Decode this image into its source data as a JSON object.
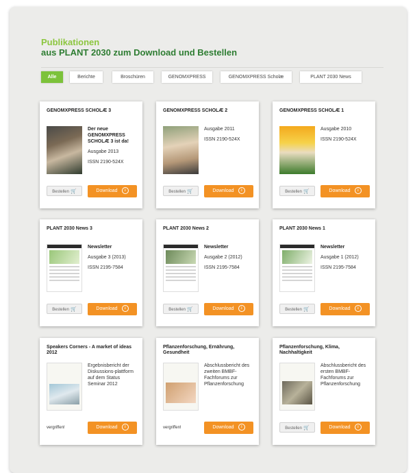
{
  "heading": {
    "line1": "Publikationen",
    "line2": "aus PLANT 2030 zum Download und Bestellen"
  },
  "tabs": [
    {
      "label": "Alle",
      "active": true
    },
    {
      "label": "Berichte"
    },
    {
      "label": "Broschüren"
    },
    {
      "label": "GENOMXPRESS"
    },
    {
      "label": "GENOMXPRESS Scholæ"
    },
    {
      "label": "PLANT 2030 News"
    }
  ],
  "cards": [
    {
      "title": "GENOMXPRESS SCHOLÆ 3",
      "info": [
        "Der neue GENOMXPRESS SCHOLÆ 3 ist da!",
        "Ausgabe 2013",
        "ISSN 2190-524X"
      ],
      "bestellen": "Bestellen",
      "download": "Download"
    },
    {
      "title": "GENOMXPRESS SCHOLÆ 2",
      "info": [
        "Ausgabe 2011",
        "ISSN 2190-524X"
      ],
      "bestellen": "Bestellen",
      "download": "Download"
    },
    {
      "title": "GENOMXPRESS SCHOLÆ 1",
      "info": [
        "Ausgabe 2010",
        "ISSN 2190-524X"
      ],
      "bestellen": "Bestellen",
      "download": "Download"
    },
    {
      "title": "PLANT 2030 News 3",
      "info": [
        "Newsletter",
        "Ausgabe 3 (2013)",
        "ISSN 2195-7584"
      ],
      "bestellen": "Bestellen",
      "download": "Download"
    },
    {
      "title": "PLANT 2030 News 2",
      "info": [
        "Newsletter",
        "Ausgabe 2 (2012)",
        "ISSN 2195-7584"
      ],
      "bestellen": "Bestellen",
      "download": "Download"
    },
    {
      "title": "PLANT 2030 News 1",
      "info": [
        "Newsletter",
        "Ausgabe 1 (2012)",
        "ISSN 2195-7584"
      ],
      "bestellen": "Bestellen",
      "download": "Download"
    },
    {
      "title": "Speakers Corners - A market of ideas 2012",
      "info": [
        "Ergebnisbericht der Diskussions-plattform auf dem Status Seminar 2012"
      ],
      "vergriffen": "vergriffen!",
      "download": "Download"
    },
    {
      "title": "Pflanzenforschung, Ernährung, Gesundheit",
      "info": [
        "Abschlussbericht des zweiten BMBF-Fachforums zur Pflanzenforschung"
      ],
      "vergriffen": "vergriffen!",
      "download": "Download"
    },
    {
      "title": "Pflanzenforschung, Klima, Nachhaltigkeit",
      "info": [
        "Abschlussbericht des ersten BMBF-Fachforums zur Pflanzenforschung"
      ],
      "bestellen": "Bestellen",
      "download": "Download"
    }
  ],
  "colors": {
    "accent_green": "#8cc63f",
    "dark_green": "#2e7d32",
    "download_orange": "#f39224"
  },
  "icons": {
    "cart": "shopping-cart-icon",
    "download": "download-circle-icon"
  }
}
